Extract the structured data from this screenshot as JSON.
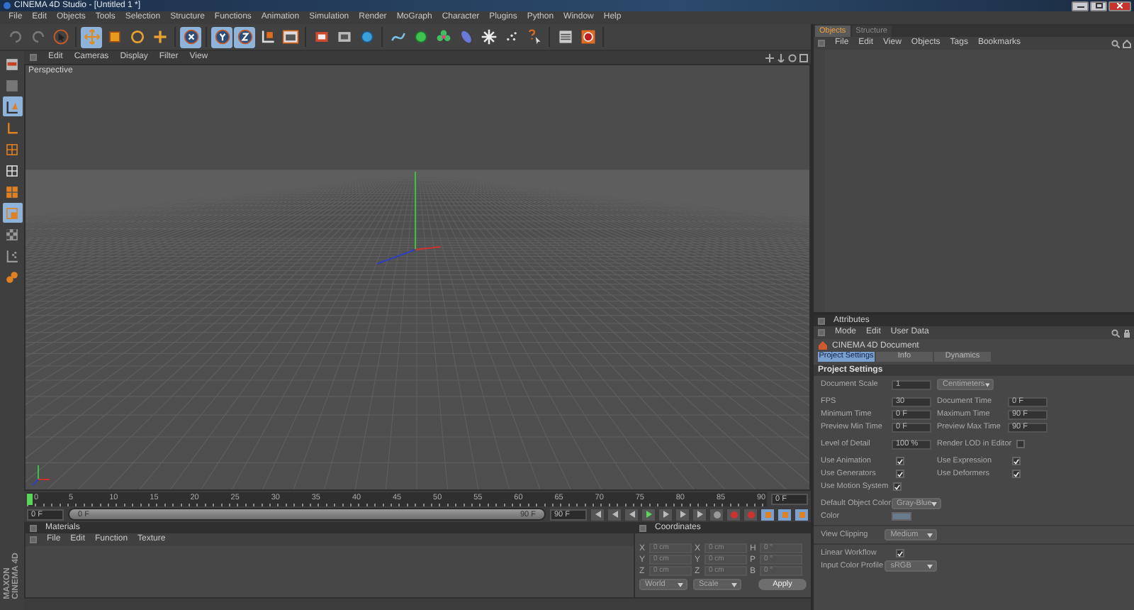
{
  "window": {
    "title": "CINEMA 4D Studio - [Untitled 1 *]"
  },
  "menu": [
    "File",
    "Edit",
    "Objects",
    "Tools",
    "Selection",
    "Structure",
    "Functions",
    "Animation",
    "Simulation",
    "Render",
    "MoGraph",
    "Character",
    "Plugins",
    "Python",
    "Window",
    "Help"
  ],
  "toolbar": [
    {
      "selected": false
    },
    {
      "selected": false
    },
    {
      "selected": false
    },
    {
      "selected": true
    },
    {
      "selected": false
    },
    {
      "selected": false
    },
    {
      "selected": false
    },
    {
      "selected": true
    },
    {
      "selected": true
    },
    {
      "selected": true
    },
    {
      "selected": false
    },
    {
      "selected": false
    },
    {
      "selected": false
    },
    {
      "selected": false
    },
    {
      "selected": false
    },
    {
      "selected": false
    },
    {
      "selected": false
    },
    {
      "selected": false
    },
    {
      "selected": false
    },
    {
      "selected": false
    },
    {
      "selected": false
    },
    {
      "selected": false
    },
    {
      "selected": false
    },
    {
      "selected": false
    }
  ],
  "side_tools": [
    {
      "selected": false
    },
    {
      "selected": false
    },
    {
      "selected": true
    },
    {
      "selected": false
    },
    {
      "selected": false
    },
    {
      "selected": false
    },
    {
      "selected": false
    },
    {
      "selected": true
    },
    {
      "selected": false
    },
    {
      "selected": false
    },
    {
      "selected": false
    }
  ],
  "logo": [
    "MAXON",
    "CINEMA 4D"
  ],
  "viewport": {
    "menu": [
      "Edit",
      "Cameras",
      "Display",
      "Filter",
      "View"
    ],
    "label": "Perspective"
  },
  "timeline": {
    "ticks": [
      "0",
      "5",
      "10",
      "15",
      "20",
      "25",
      "30",
      "35",
      "40",
      "45",
      "50",
      "55",
      "60",
      "65",
      "70",
      "75",
      "80",
      "85",
      "90"
    ],
    "playhead": {
      "level": 0
    },
    "current": "0 F",
    "start": "0 F",
    "range": {
      "level": 1
    },
    "range_start": "0 F",
    "range_end": "90 F",
    "end": "90 F"
  },
  "materials": {
    "title": "Materials",
    "menu": [
      "File",
      "Edit",
      "Function",
      "Texture"
    ]
  },
  "coordinates": {
    "title": "Coordinates",
    "rows": [
      {
        "a": "X",
        "position": "0 cm",
        "b": "X",
        "size": "0 cm",
        "c": "H",
        "rotation": "0 °"
      },
      {
        "a": "Y",
        "position": "0 cm",
        "b": "Y",
        "size": "0 cm",
        "c": "P",
        "rotation": "0 °"
      },
      {
        "a": "Z",
        "position": "0 cm",
        "b": "Z",
        "size": "0 cm",
        "c": "B",
        "rotation": "0 °"
      }
    ],
    "mode": "World",
    "type": "Scale",
    "apply": "Apply"
  },
  "objects_panel": {
    "tabs": [
      {
        "label": "Objects",
        "selected": true
      },
      {
        "label": "Structure",
        "selected": false
      }
    ],
    "menu": [
      "File",
      "Edit",
      "View",
      "Objects",
      "Tags",
      "Bookmarks"
    ]
  },
  "attributes": {
    "title": "Attributes",
    "menu": [
      "Mode",
      "Edit",
      "User Data"
    ],
    "object": "CINEMA 4D Document",
    "tabs": [
      {
        "label": "Project Settings",
        "selected": true
      },
      {
        "label": "Info",
        "selected": false
      },
      {
        "label": "Dynamics",
        "selected": false
      }
    ],
    "section": "Project Settings",
    "groups": [
      {
        "divider": false,
        "rows": [
          [
            {
              "kind": "number",
              "label": "Document Scale",
              "value": "1"
            },
            {
              "kind": "dropdown",
              "value": "Centimeters"
            }
          ]
        ]
      },
      {
        "divider": false,
        "rows": [
          [
            {
              "kind": "number",
              "label": "FPS",
              "value": "30"
            },
            {
              "kind": "number",
              "label": "Document Time",
              "value": "0 F"
            }
          ],
          [
            {
              "kind": "number",
              "label": "Minimum Time",
              "value": "0 F"
            },
            {
              "kind": "number",
              "label": "Maximum Time",
              "value": "90 F"
            }
          ],
          [
            {
              "kind": "number",
              "label": "Preview Min Time",
              "value": "0 F"
            },
            {
              "kind": "number",
              "label": "Preview Max Time",
              "value": "90 F"
            }
          ]
        ]
      },
      {
        "divider": false,
        "rows": [
          [
            {
              "kind": "number",
              "label": "Level of Detail",
              "value": "100 %"
            },
            {
              "kind": "checkbox",
              "label": "Render LOD in Editor",
              "checked": false
            }
          ]
        ]
      },
      {
        "divider": false,
        "rows": [
          [
            {
              "kind": "checkbox",
              "label": "Use Animation",
              "checked": true
            },
            {
              "kind": "checkbox",
              "label": "Use Expression",
              "checked": true
            }
          ],
          [
            {
              "kind": "checkbox",
              "label": "Use Generators",
              "checked": true
            },
            {
              "kind": "checkbox",
              "label": "Use Deformers",
              "checked": true
            }
          ],
          [
            {
              "kind": "checkbox",
              "label": "Use Motion System",
              "checked": true
            }
          ]
        ]
      },
      {
        "divider": false,
        "rows": [
          [
            {
              "kind": "dropdown",
              "label": "Default Object Color",
              "value": "Gray-Blue"
            }
          ],
          [
            {
              "kind": "swatch",
              "label": "Color",
              "color": "#6b7a8c"
            }
          ]
        ]
      },
      {
        "divider": true,
        "rows": [
          [
            {
              "kind": "dropdown",
              "label": "View Clipping",
              "value": "Medium"
            }
          ]
        ]
      },
      {
        "divider": true,
        "rows": [
          [
            {
              "kind": "checkbox",
              "label": "Linear Workflow",
              "checked": true
            }
          ],
          [
            {
              "kind": "dropdown",
              "label": "Input Color Profile",
              "value": "sRGB"
            }
          ]
        ]
      }
    ]
  }
}
